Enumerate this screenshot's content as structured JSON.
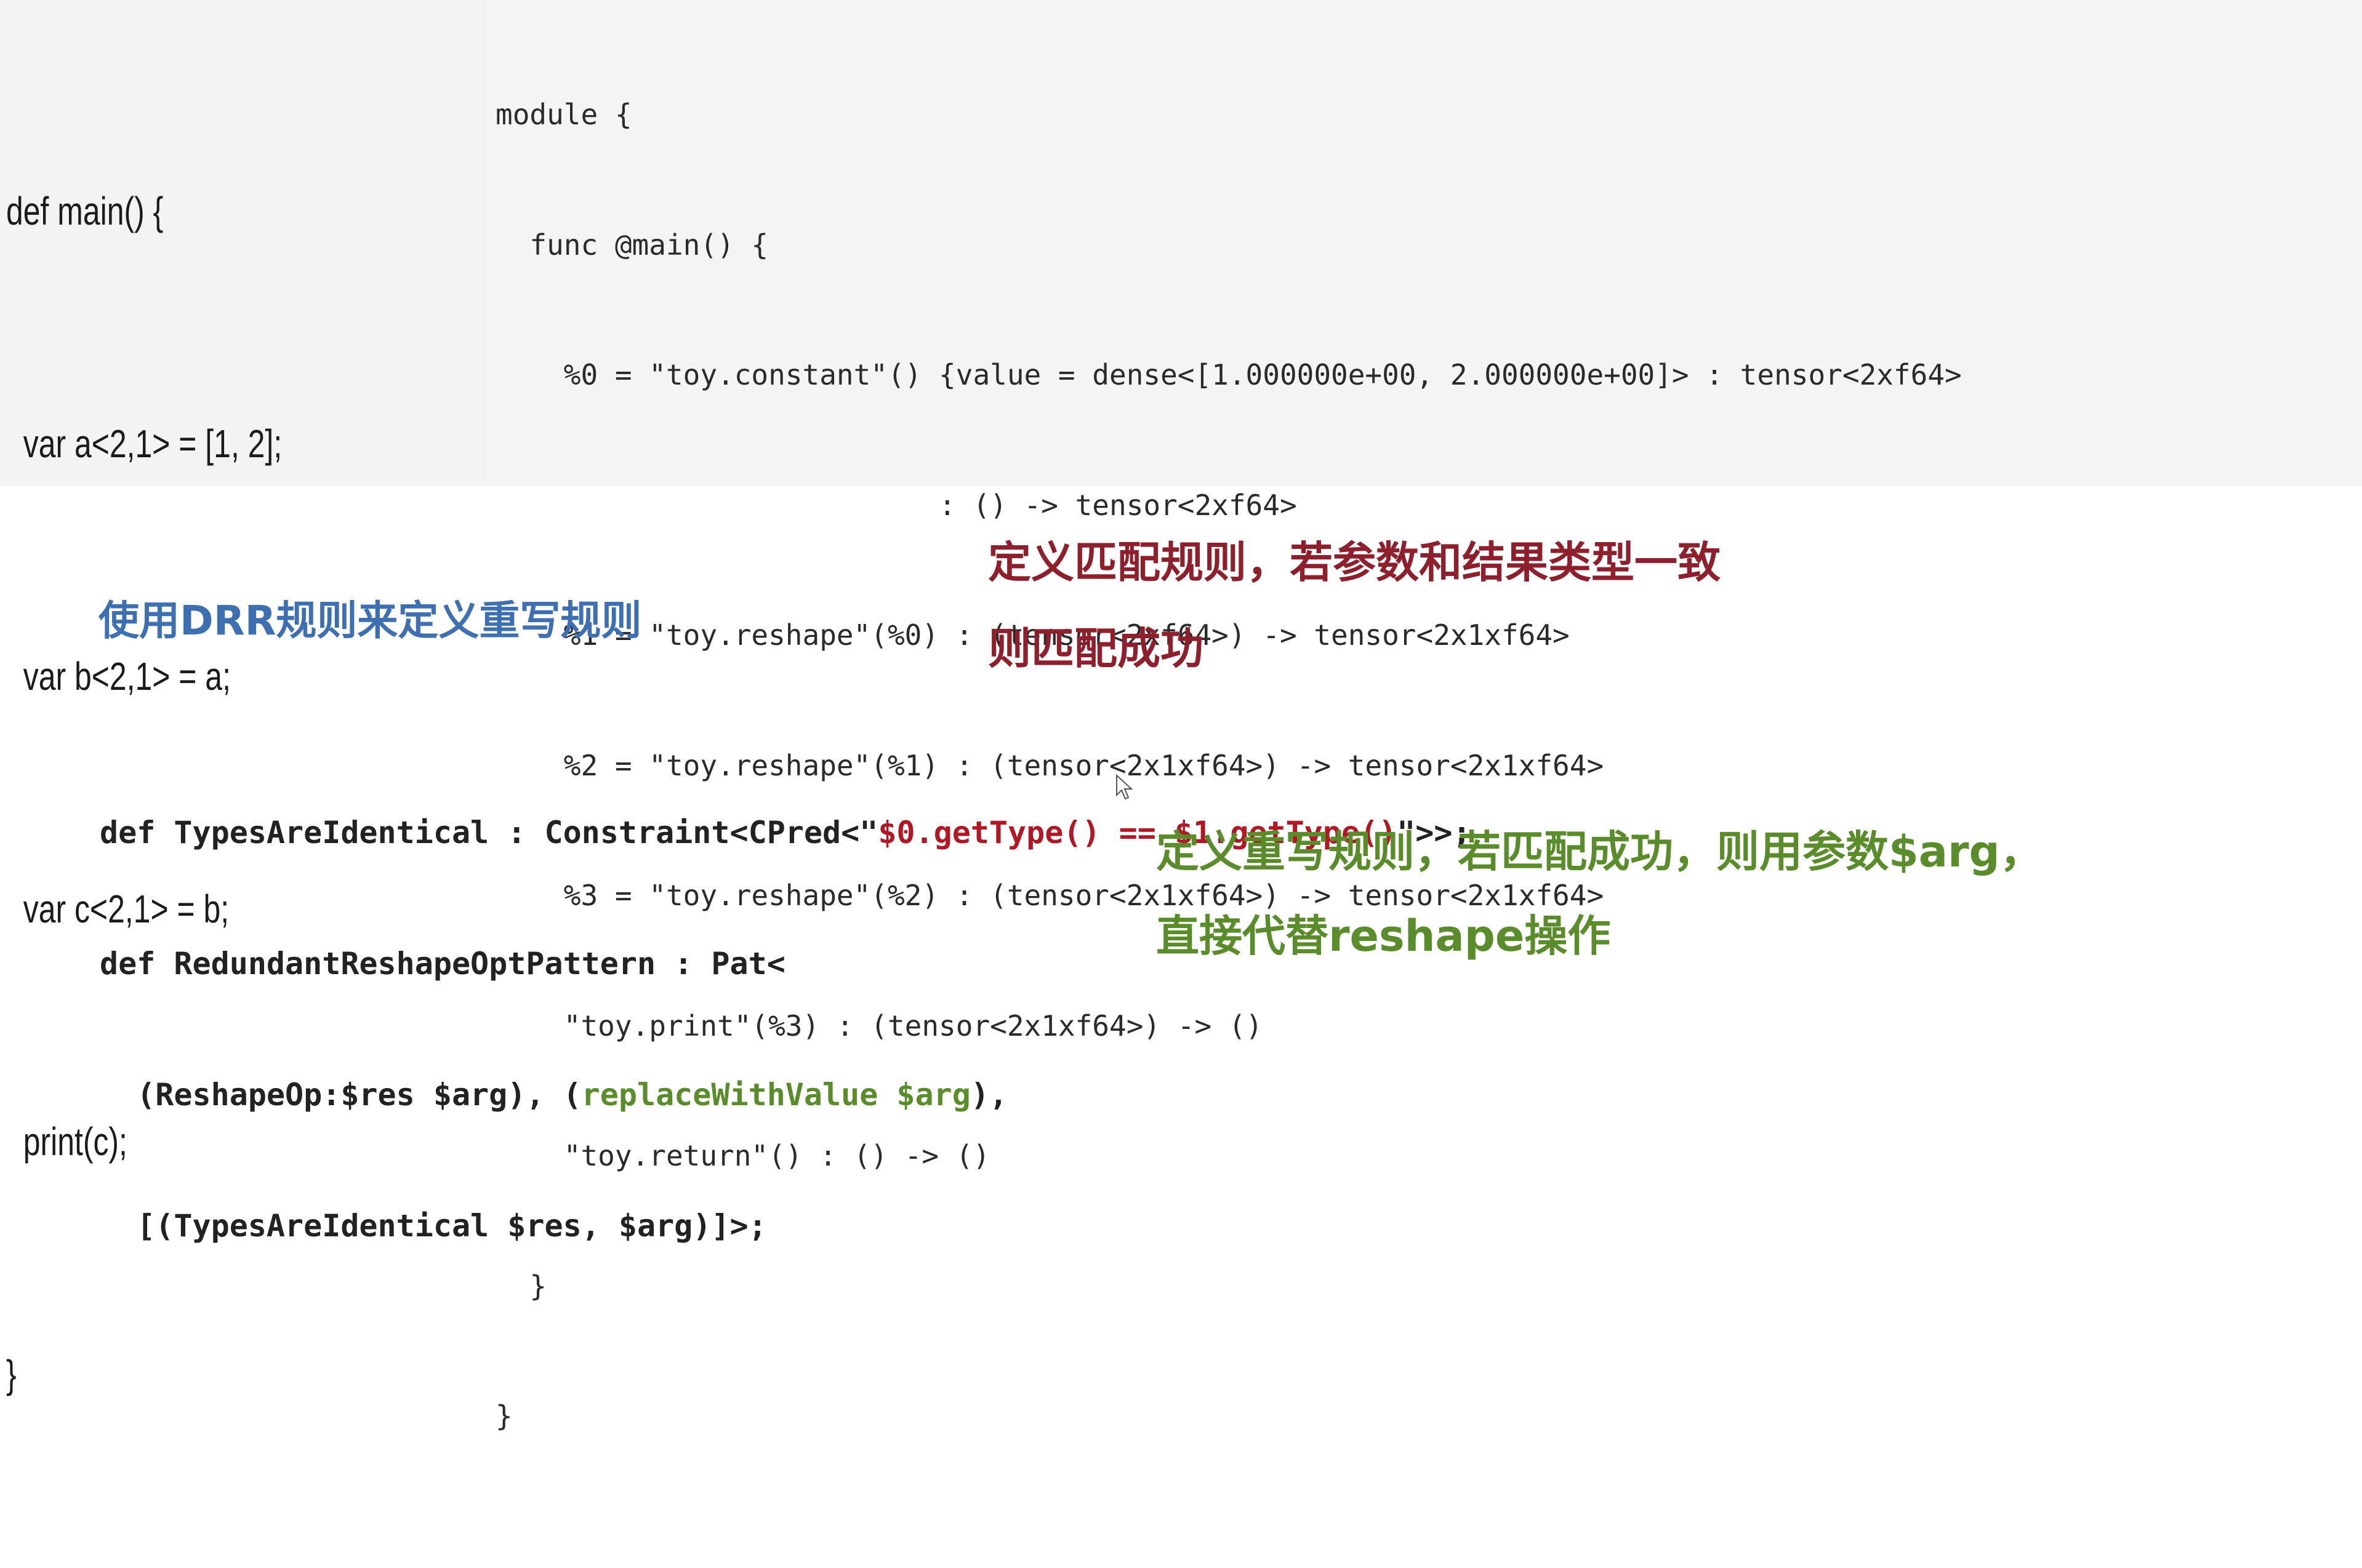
{
  "toy_source": {
    "lines": [
      "def main() {",
      "  var a<2,1> = [1, 2];",
      "  var b<2,1> = a;",
      "  var c<2,1> = b;",
      "  print(c);",
      "}"
    ]
  },
  "mlir_ir": {
    "lines": [
      "module {",
      "  func @main() {",
      "    %0 = \"toy.constant\"() {value = dense<[1.000000e+00, 2.000000e+00]> : tensor<2xf64>",
      "                          : () -> tensor<2xf64>",
      "    %1 = \"toy.reshape\"(%0) : (tensor<2xf64>) -> tensor<2x1xf64>",
      "    %2 = \"toy.reshape\"(%1) : (tensor<2x1xf64>) -> tensor<2x1xf64>",
      "    %3 = \"toy.reshape\"(%2) : (tensor<2x1xf64>) -> tensor<2x1xf64>",
      "    \"toy.print\"(%3) : (tensor<2x1xf64>) -> ()",
      "    \"toy.return\"() : () -> ()",
      "  }",
      "}"
    ]
  },
  "heading": "使用DRR规则来定义重写规则",
  "match_note": {
    "line1": "定义匹配规则，若参数和结果类型一致",
    "line2": "则匹配成功"
  },
  "drr_code": {
    "line1_prefix": "def TypesAreIdentical : Constraint<CPred<\"",
    "line1_pred": "$0.getType() == $1.getType()",
    "line1_suffix": "\">>;",
    "line2": "def RedundantReshapeOptPattern : Pat<",
    "line3_prefix": "  (ReshapeOp:$res $arg), (",
    "line3_replace": "replaceWithValue $arg",
    "line3_suffix": "),",
    "line4": "  [(TypesAreIdentical $res, $arg)]>;"
  },
  "rewrite_note": {
    "line1": "定义重写规则，若匹配成功，则用参数$arg，",
    "line2": "直接代替reshape操作"
  },
  "colors": {
    "heading": "#3e6fb0",
    "match_note": "#8e1f2c",
    "rewrite_note": "#5a8c2b",
    "predicate": "#b01826"
  }
}
